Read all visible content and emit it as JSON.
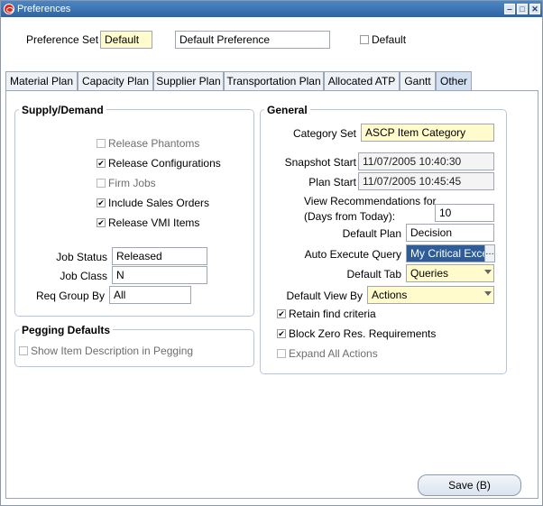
{
  "window": {
    "title": "Preferences",
    "min": "‒",
    "max": "□",
    "close": "✕"
  },
  "header": {
    "preference_set_label": "Preference Set",
    "preference_set_value": "Default",
    "description_value": "Default Preference",
    "default_checkbox_label": "Default"
  },
  "tabs": [
    {
      "label": "Material Plan"
    },
    {
      "label": "Capacity Plan"
    },
    {
      "label": "Supplier Plan"
    },
    {
      "label": "Transportation Plan"
    },
    {
      "label": "Allocated ATP"
    },
    {
      "label": "Gantt"
    },
    {
      "label": "Other"
    }
  ],
  "active_tab": "Other",
  "supply_demand": {
    "title": "Supply/Demand",
    "checkboxes": [
      {
        "label": "Release Phantoms",
        "checked": false,
        "disabled": true
      },
      {
        "label": "Release Configurations",
        "checked": true,
        "disabled": false
      },
      {
        "label": "Firm Jobs",
        "checked": false,
        "disabled": true
      },
      {
        "label": "Include Sales Orders",
        "checked": true,
        "disabled": false
      },
      {
        "label": "Release VMI Items",
        "checked": true,
        "disabled": false
      }
    ],
    "job_status_label": "Job Status",
    "job_status_value": "Released",
    "job_class_label": "Job Class",
    "job_class_value": "N",
    "req_group_label": "Req Group By",
    "req_group_value": "All"
  },
  "pegging": {
    "title": "Pegging Defaults",
    "show_item_desc_label": "Show Item Description in Pegging",
    "show_item_desc_checked": false
  },
  "general": {
    "title": "General",
    "category_set_label": "Category Set",
    "category_set_value": "ASCP Item Category",
    "snapshot_start_label": "Snapshot Start",
    "snapshot_start_value": "11/07/2005 10:40:30",
    "plan_start_label": "Plan Start",
    "plan_start_value": "11/07/2005 10:45:45",
    "view_recs_label_1": "View Recommendations for",
    "view_recs_label_2": "(Days from Today):",
    "view_recs_value": "10",
    "default_plan_label": "Default Plan",
    "default_plan_value": "Decision",
    "auto_exec_label": "Auto Execute Query",
    "auto_exec_value": "My Critical Exce",
    "lov_label": "…",
    "default_tab_label": "Default Tab",
    "default_tab_value": "Queries",
    "default_view_label": "Default View By",
    "default_view_value": "Actions",
    "retain_find_label": "Retain find criteria",
    "retain_find_checked": true,
    "block_zero_label": "Block Zero Res. Requirements",
    "block_zero_checked": true,
    "expand_actions_label": "Expand All Actions",
    "expand_actions_checked": false
  },
  "footer": {
    "save_label": "Save (B)"
  },
  "colors": {
    "accent": "#2f64a4",
    "required_field": "#fffbcc",
    "selected_text_bg": "#2e5c99"
  }
}
